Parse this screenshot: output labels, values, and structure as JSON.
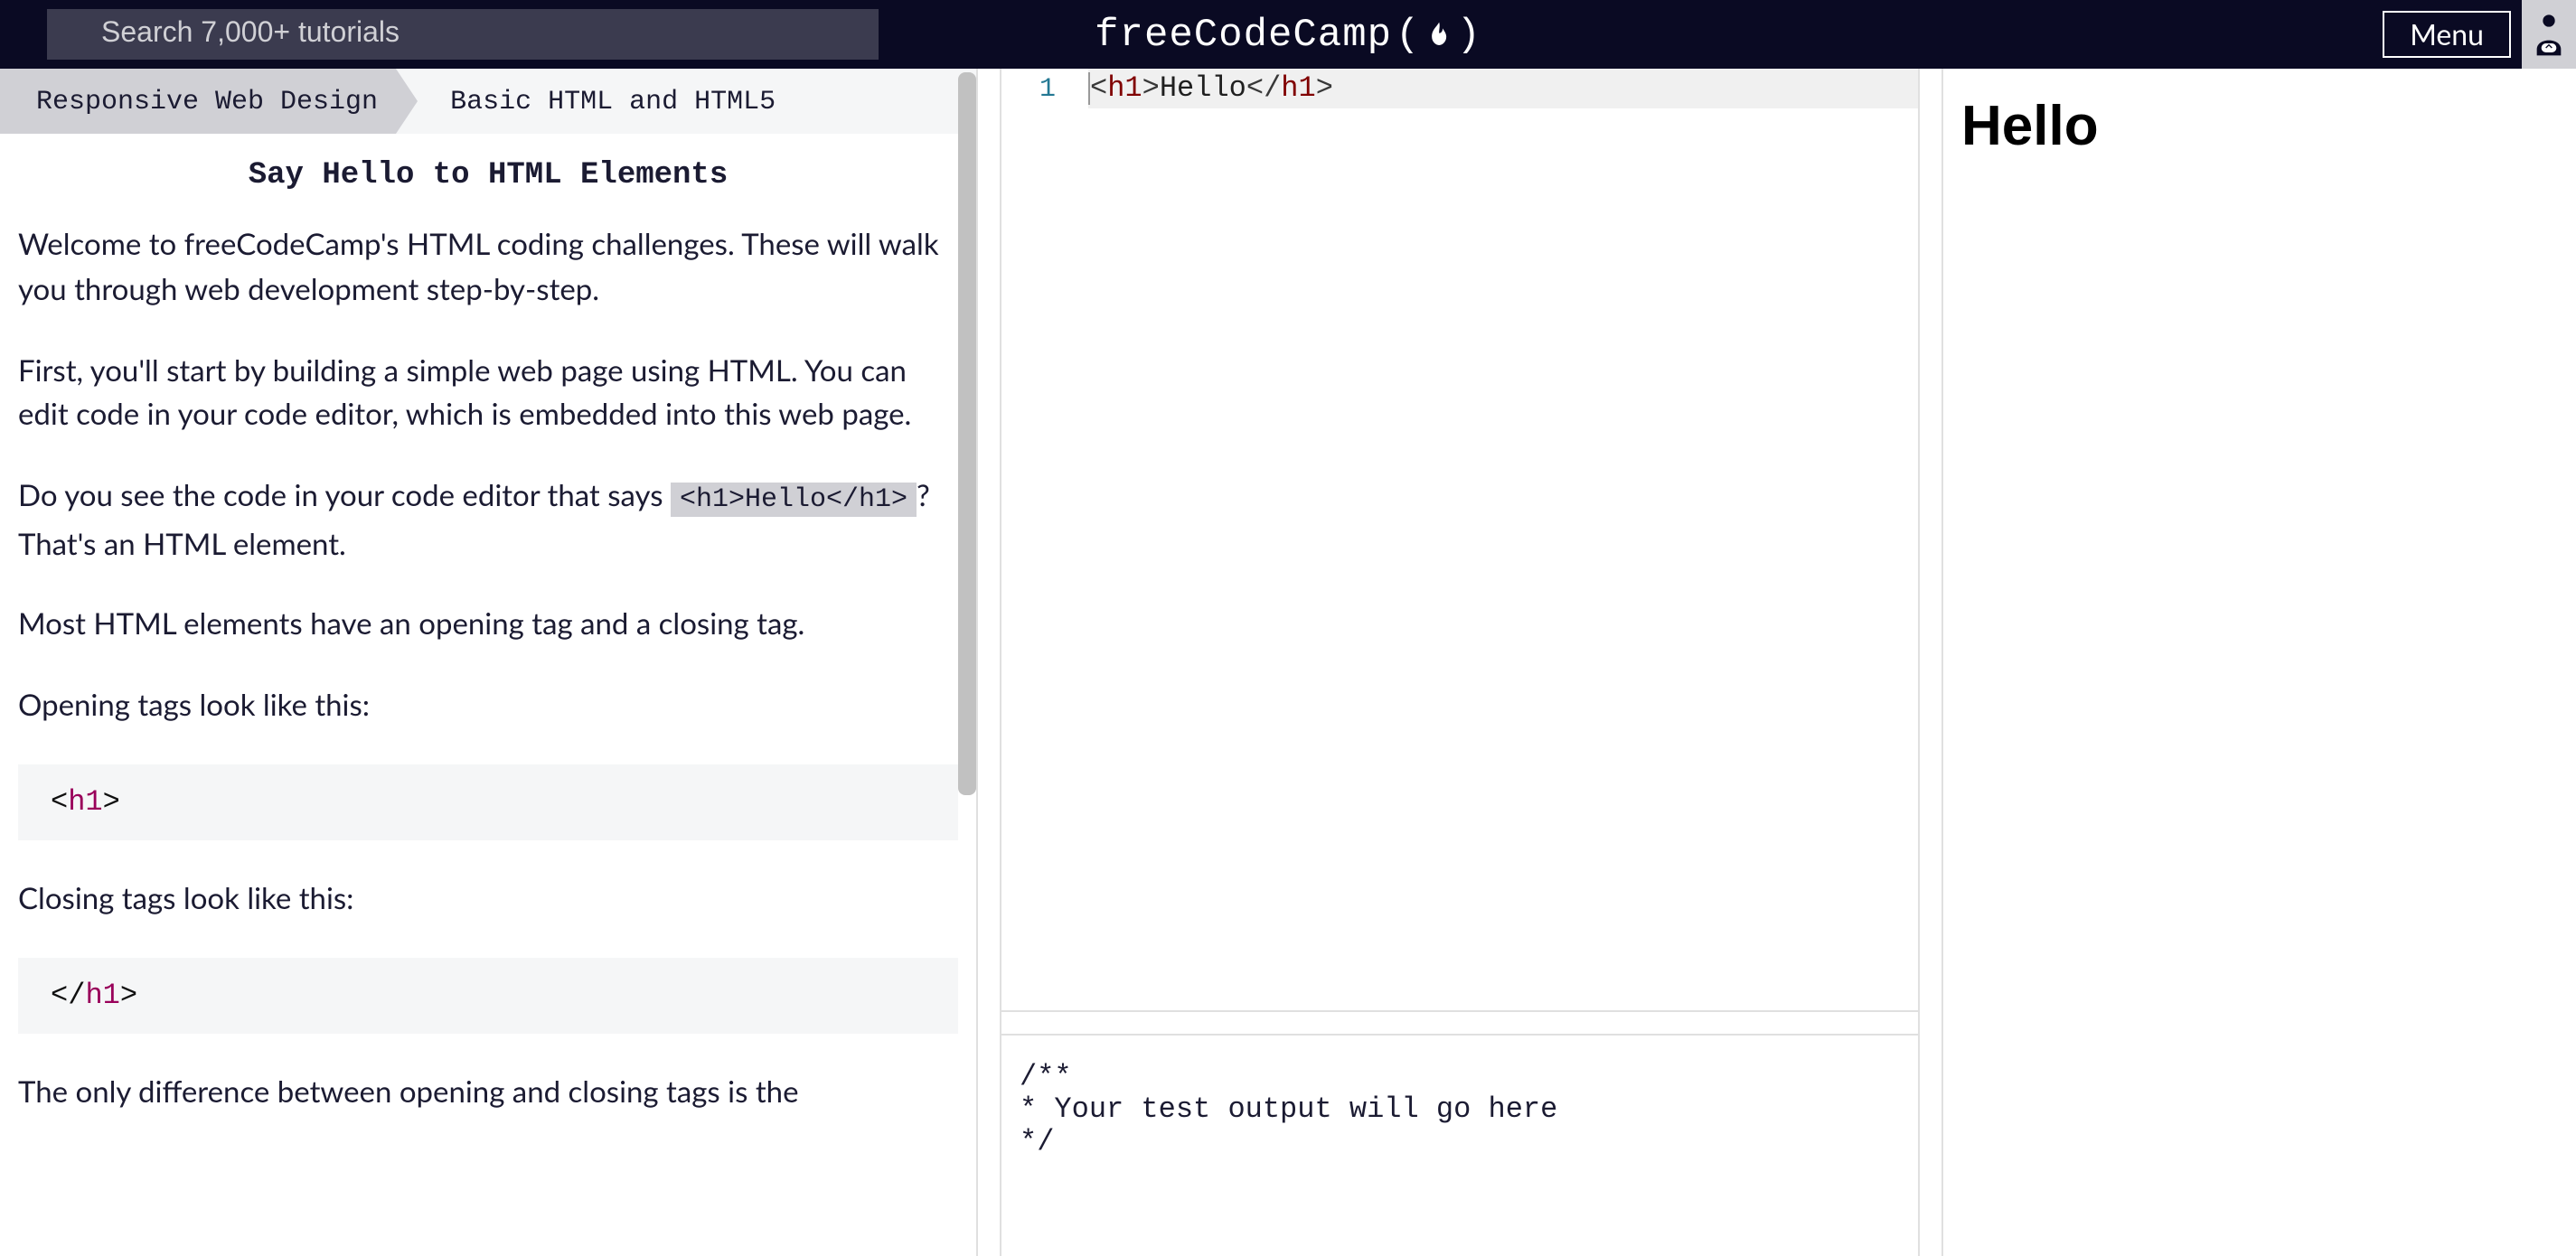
{
  "nav": {
    "search_placeholder": "Search 7,000+ tutorials",
    "logo_text": "freeCodeCamp",
    "menu_label": "Menu"
  },
  "breadcrumb": {
    "course": "Responsive Web Design",
    "section": "Basic HTML and HTML5"
  },
  "challenge": {
    "title": "Say Hello to HTML Elements",
    "p1": "Welcome to freeCodeCamp's HTML coding challenges. These will walk you through web development step-by-step.",
    "p2": "First, you'll start by building a simple web page using HTML. You can edit code in your code editor, which is embedded into this web page.",
    "p3a": "Do you see the code in your code editor that says ",
    "p3_code": "<h1>Hello</h1>",
    "p3b": "? That's an HTML element.",
    "p4": "Most HTML elements have an opening tag and a closing tag.",
    "p5": "Opening tags look like this:",
    "code1_tag": "h1",
    "p6": "Closing tags look like this:",
    "code2_tag": "h1",
    "p7": "The only difference between opening and closing tags is the"
  },
  "editor": {
    "line_number": "1",
    "code_tag_open": "h1",
    "code_text": "Hello",
    "code_tag_close": "h1"
  },
  "output": {
    "text": "/**\n* Your test output will go here\n*/"
  },
  "preview": {
    "heading": "Hello"
  }
}
